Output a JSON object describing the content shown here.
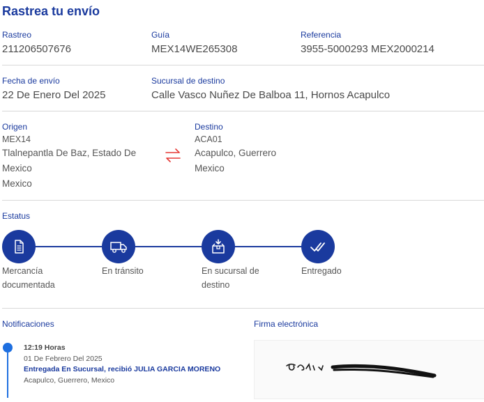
{
  "page": {
    "title": "Rastrea tu envío"
  },
  "info": {
    "rastreo_label": "Rastreo",
    "rastreo_value": "211206507676",
    "guia_label": "Guía",
    "guia_value": "MEX14WE265308",
    "referencia_label": "Referencia",
    "referencia_value": "3955-5000293 MEX2000214",
    "fecha_label": "Fecha de envío",
    "fecha_value": "22 De Enero Del 2025",
    "sucursal_label": "Sucursal de destino",
    "sucursal_value": "Calle Vasco Nuñez De Balboa 11, Hornos Acapulco"
  },
  "origen": {
    "label": "Origen",
    "code": "MEX14",
    "line1": "Tlalnepantla De Baz, Estado De",
    "line2": "Mexico",
    "line3": "Mexico"
  },
  "destino": {
    "label": "Destino",
    "code": "ACA01",
    "line1": "Acapulco, Guerrero",
    "line2": "Mexico"
  },
  "estatus": {
    "label": "Estatus",
    "steps": [
      {
        "line1": "Mercancía",
        "line2": "documentada",
        "icon": "document-icon"
      },
      {
        "line1": "En tránsito",
        "line2": "",
        "icon": "truck-icon"
      },
      {
        "line1": "En sucursal de",
        "line2": "destino",
        "icon": "package-icon"
      },
      {
        "line1": "Entregado",
        "line2": "",
        "icon": "double-check-icon"
      }
    ]
  },
  "notificaciones": {
    "label": "Notificaciones",
    "time": "12:19 Horas",
    "date": "01 De Febrero Del 2025",
    "status": "Entregada En Sucursal, recibió JULIA GARCIA MORENO",
    "location": "Acapulco, Guerrero, Mexico"
  },
  "firma": {
    "label": "Firma electrónica"
  },
  "colors": {
    "primary": "#1a3a9e",
    "accent": "#1e6fe0",
    "swap": "#e53935",
    "divider": "#d8d8d8"
  }
}
